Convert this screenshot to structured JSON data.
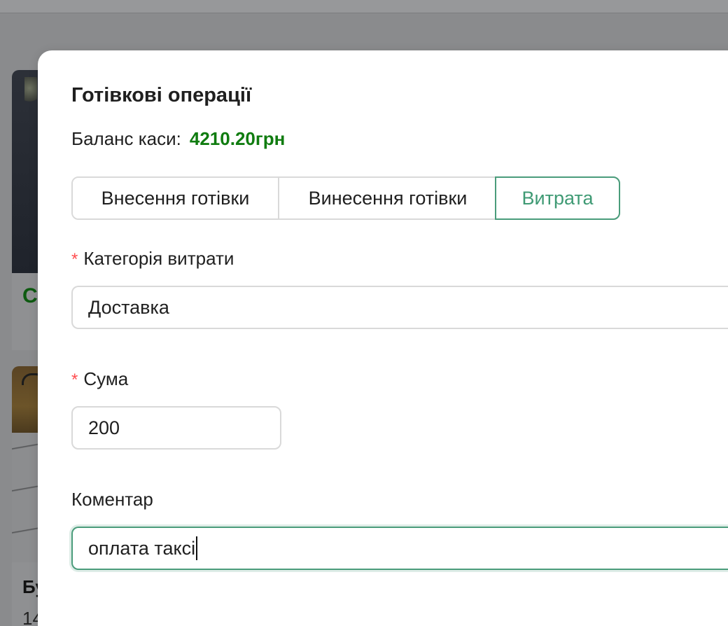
{
  "background": {
    "card1_text": "C",
    "card2_title": "Бу",
    "card2_sub": "14"
  },
  "modal": {
    "title": "Готівкові операції",
    "balance_label": "Баланс каси:",
    "balance_value": "4210.20грн",
    "balance_color": "#107c10",
    "accent_color": "#4a9c7b",
    "tabs": [
      {
        "label": "Внесення готівки",
        "selected": false
      },
      {
        "label": "Винесення готівки",
        "selected": false
      },
      {
        "label": "Витрата",
        "selected": true
      }
    ],
    "category": {
      "required_mark": "*",
      "label": "Категорія витрати",
      "value": "Доставка"
    },
    "amount": {
      "required_mark": "*",
      "label": "Сума",
      "value": "200"
    },
    "comment": {
      "label": "Коментар",
      "value": "оплата таксі"
    }
  }
}
